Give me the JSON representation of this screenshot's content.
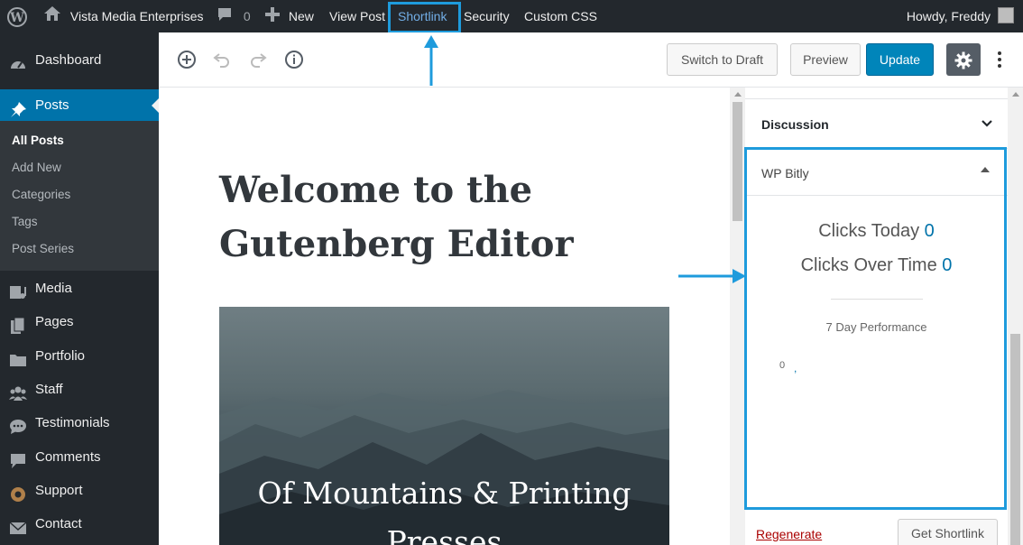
{
  "adminbar": {
    "site_name": "Vista Media Enterprises",
    "comment_count": "0",
    "new_label": "New",
    "view_post": "View Post",
    "shortlink": "Shortlink",
    "security": "Security",
    "custom_css": "Custom CSS",
    "howdy": "Howdy, Freddy"
  },
  "sidebar": {
    "items": [
      {
        "label": "Dashboard",
        "icon": "dashboard-icon"
      },
      {
        "label": "Posts",
        "icon": "pin-icon"
      },
      {
        "label": "Media",
        "icon": "media-icon"
      },
      {
        "label": "Pages",
        "icon": "pages-icon"
      },
      {
        "label": "Portfolio",
        "icon": "portfolio-icon"
      },
      {
        "label": "Staff",
        "icon": "staff-icon"
      },
      {
        "label": "Testimonials",
        "icon": "testimonials-icon"
      },
      {
        "label": "Comments",
        "icon": "comments-icon"
      },
      {
        "label": "Support",
        "icon": "support-icon"
      },
      {
        "label": "Contact",
        "icon": "contact-icon"
      }
    ],
    "posts_submenu": [
      "All Posts",
      "Add New",
      "Categories",
      "Tags",
      "Post Series"
    ]
  },
  "toolbar": {
    "switch_to_draft": "Switch to Draft",
    "preview": "Preview",
    "update": "Update"
  },
  "post": {
    "title": "Welcome to the Gutenberg Editor",
    "cover_text": "Of Mountains & Printing Presses"
  },
  "settings": {
    "discussion": "Discussion",
    "bitly_title": "WP Bitly",
    "clicks_today_label": "Clicks Today",
    "clicks_today_value": "0",
    "clicks_over_time_label": "Clicks Over Time",
    "clicks_over_time_value": "0",
    "performance_label": "7 Day Performance",
    "axis_zero": "0",
    "regenerate": "Regenerate",
    "get_shortlink": "Get Shortlink"
  },
  "colors": {
    "admin_bg": "#23282d",
    "accent": "#0073aa",
    "highlight": "#1e9bdc"
  }
}
